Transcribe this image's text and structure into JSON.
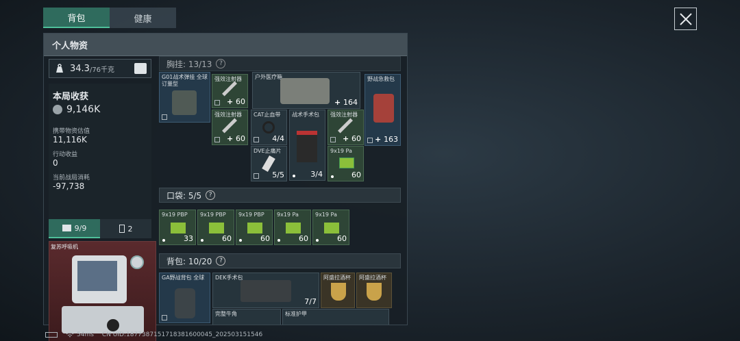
{
  "tabs": [
    "背包",
    "健康"
  ],
  "panel_title": "个人物资",
  "weight": {
    "value": "34.3",
    "max": "/76千克"
  },
  "earn": {
    "title": "本局收获",
    "total": "9,146K",
    "stats": [
      {
        "label": "携带物资估值",
        "value": "11,116K"
      },
      {
        "label": "行动收益",
        "value": "0"
      },
      {
        "label": "当前战局消耗",
        "value": "-97,738"
      }
    ]
  },
  "subtabs": [
    {
      "label": "9/9"
    },
    {
      "label": "2"
    }
  ],
  "equip_name": "复苏呼吸机",
  "sections": {
    "chest": "胸挂: 13/13",
    "pocket": "口袋: 5/5",
    "bag": "背包: 10/20"
  },
  "chest_items": [
    {
      "name": "G01战术弹挂 全球订量型",
      "count": ""
    },
    {
      "name": "强效注射器",
      "count": "60"
    },
    {
      "name": "户外医疗箱",
      "count": "164"
    },
    {
      "name": "野战急救包",
      "count": "163"
    },
    {
      "name": "强效注射器",
      "count": "60"
    },
    {
      "name": "CAT止血带",
      "count": "4/4"
    },
    {
      "name": "战术手术包",
      "count": ""
    },
    {
      "name": "强效注射器",
      "count": "60"
    },
    {
      "name": "DVE止痛片",
      "count": "5/5"
    },
    {
      "name": "",
      "count": "3/4"
    },
    {
      "name": "9x19 Pa",
      "count": "60"
    }
  ],
  "pocket_items": [
    {
      "name": "9x19 PBP",
      "count": "33"
    },
    {
      "name": "9x19 PBP",
      "count": "60"
    },
    {
      "name": "9x19 PBP",
      "count": "60"
    },
    {
      "name": "9x19 Pa",
      "count": "60"
    },
    {
      "name": "9x19 Pa",
      "count": "60"
    }
  ],
  "bag_items": [
    {
      "name": "GA野战背包 全球",
      "count": ""
    },
    {
      "name": "DEK手术包",
      "count": "7/7"
    },
    {
      "name": "阿盛拉酒杯",
      "count": ""
    },
    {
      "name": "阿盛拉酒杯",
      "count": ""
    },
    {
      "name": "完整牛角",
      "count": ""
    },
    {
      "name": "标准护甲",
      "count": ""
    }
  ],
  "footer": {
    "ping": "54ms",
    "uid": "CN UID:1877387151718381600045_202503151546"
  },
  "icons": [
    "close-icon",
    "weight-icon",
    "list-icon",
    "coin-icon",
    "briefcase-icon",
    "battery-icon",
    "wifi-icon"
  ]
}
